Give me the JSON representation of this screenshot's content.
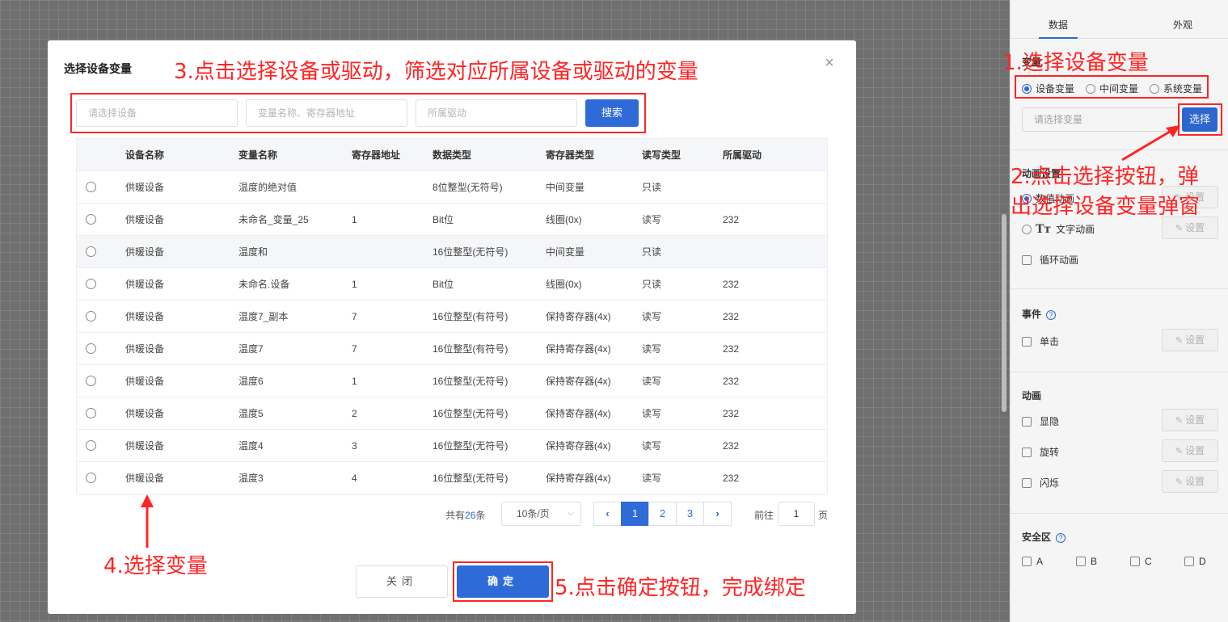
{
  "right_panel": {
    "tabs": [
      "数据",
      "外观"
    ],
    "variable": {
      "label": "变量",
      "types": [
        "设备变量",
        "中间变量",
        "系统变量"
      ],
      "selected_type": "设备变量",
      "input_placeholder": "请选择变量",
      "select_button": "选择"
    },
    "animation_settings": {
      "label": "动画设置",
      "options": [
        "数值动画",
        "文字动画",
        "循环动画"
      ],
      "set_label": "设置"
    },
    "events": {
      "label": "事件",
      "help": "?",
      "options": [
        "单击"
      ],
      "set_label": "设置"
    },
    "animation": {
      "label": "动画",
      "options": [
        "显隐",
        "旋转",
        "闪烁"
      ],
      "set_label": "设置"
    },
    "safe_zone": {
      "label": "安全区",
      "help": "?",
      "options": [
        "A",
        "B",
        "C",
        "D"
      ]
    }
  },
  "dialog": {
    "title": "选择设备变量",
    "close_glyph": "×",
    "search": {
      "device_placeholder": "请选择设备",
      "name_placeholder": "变量名称、寄存器地址",
      "driver_placeholder": "所属驱动",
      "button": "搜索"
    },
    "columns": [
      "设备名称",
      "变量名称",
      "寄存器地址",
      "数据类型",
      "寄存器类型",
      "读写类型",
      "所属驱动"
    ],
    "rows": [
      {
        "device": "供暖设备",
        "name": "温度的绝对值",
        "addr": "",
        "dtype": "8位整型(无符号)",
        "rtype": "中间变量",
        "rw": "只读",
        "driver": ""
      },
      {
        "device": "供暖设备",
        "name": "未命名_变量_25",
        "addr": "1",
        "dtype": "Bit位",
        "rtype": "线圈(0x)",
        "rw": "读写",
        "driver": "232"
      },
      {
        "device": "供暖设备",
        "name": "温度和",
        "addr": "",
        "dtype": "16位整型(无符号)",
        "rtype": "中间变量",
        "rw": "只读",
        "driver": ""
      },
      {
        "device": "供暖设备",
        "name": "未命名.设备",
        "addr": "1",
        "dtype": "Bit位",
        "rtype": "线圈(0x)",
        "rw": "只读",
        "driver": "232"
      },
      {
        "device": "供暖设备",
        "name": "温度7_副本",
        "addr": "7",
        "dtype": "16位整型(有符号)",
        "rtype": "保持寄存器(4x)",
        "rw": "读写",
        "driver": "232"
      },
      {
        "device": "供暖设备",
        "name": "温度7",
        "addr": "7",
        "dtype": "16位整型(有符号)",
        "rtype": "保持寄存器(4x)",
        "rw": "读写",
        "driver": "232"
      },
      {
        "device": "供暖设备",
        "name": "温度6",
        "addr": "1",
        "dtype": "16位整型(无符号)",
        "rtype": "保持寄存器(4x)",
        "rw": "读写",
        "driver": "232"
      },
      {
        "device": "供暖设备",
        "name": "温度5",
        "addr": "2",
        "dtype": "16位整型(无符号)",
        "rtype": "保持寄存器(4x)",
        "rw": "读写",
        "driver": "232"
      },
      {
        "device": "供暖设备",
        "name": "温度4",
        "addr": "3",
        "dtype": "16位整型(无符号)",
        "rtype": "保持寄存器(4x)",
        "rw": "读写",
        "driver": "232"
      },
      {
        "device": "供暖设备",
        "name": "温度3",
        "addr": "4",
        "dtype": "16位整型(无符号)",
        "rtype": "保持寄存器(4x)",
        "rw": "读写",
        "driver": "232"
      }
    ],
    "highlighted_row": 3,
    "pagination": {
      "total_prefix": "共有",
      "total": "26",
      "total_suffix": "条",
      "page_size": "10条/页",
      "pages": [
        "1",
        "2",
        "3"
      ],
      "current_page": "1",
      "goto_prefix": "前往",
      "goto_value": "1",
      "goto_suffix": "页",
      "prev_glyph": "‹",
      "next_glyph": "›"
    },
    "close_button": "关闭",
    "confirm_button": "确定"
  },
  "annotations": {
    "step1": "1.选择设备变量",
    "step2_line1": "2.点击选择按钮，弹",
    "step2_line2": "出选择设备变量弹窗",
    "step3": "3.点击选择设备或驱动，筛选对应所属设备或驱动的变量",
    "step4": "4.选择变量",
    "step5": "5.点击确定按钮，完成绑定"
  },
  "colors": {
    "primary": "#2f6bd8",
    "annotation": "#ff2424"
  }
}
